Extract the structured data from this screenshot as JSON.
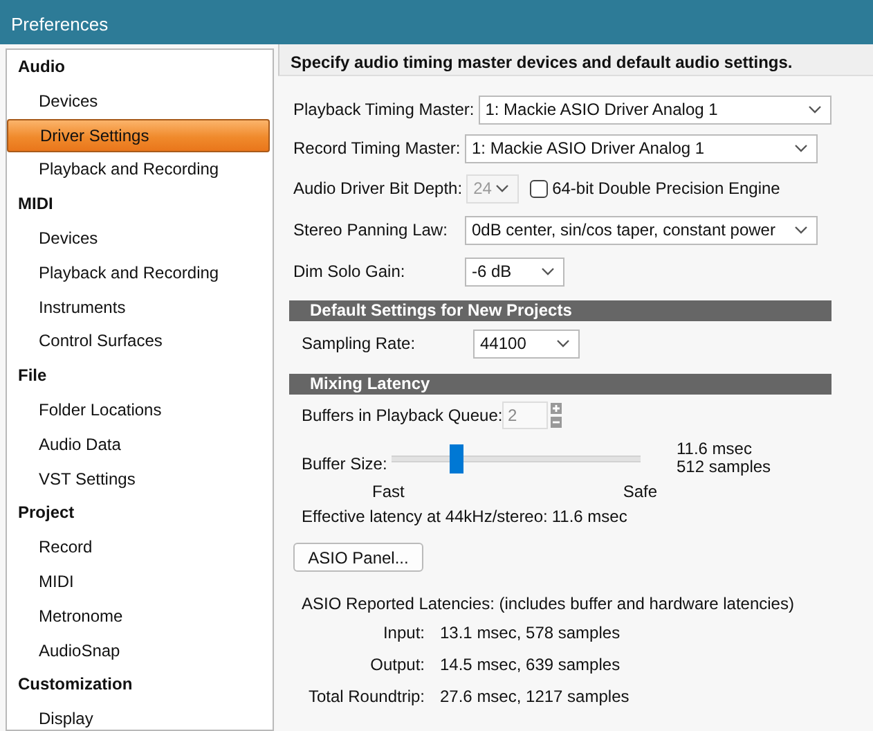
{
  "window": {
    "title": "Preferences"
  },
  "sidebar": {
    "categories": [
      {
        "label": "Audio",
        "items": [
          {
            "label": "Devices",
            "selected": false
          },
          {
            "label": "Driver Settings",
            "selected": true
          },
          {
            "label": "Playback and Recording",
            "selected": false
          }
        ]
      },
      {
        "label": "MIDI",
        "items": [
          {
            "label": "Devices",
            "selected": false
          },
          {
            "label": "Playback and Recording",
            "selected": false
          },
          {
            "label": "Instruments",
            "selected": false
          },
          {
            "label": "Control Surfaces",
            "selected": false
          }
        ]
      },
      {
        "label": "File",
        "items": [
          {
            "label": "Folder Locations",
            "selected": false
          },
          {
            "label": "Audio Data",
            "selected": false
          },
          {
            "label": "VST Settings",
            "selected": false
          }
        ]
      },
      {
        "label": "Project",
        "items": [
          {
            "label": "Record",
            "selected": false
          },
          {
            "label": "MIDI",
            "selected": false
          },
          {
            "label": "Metronome",
            "selected": false
          },
          {
            "label": "AudioSnap",
            "selected": false
          }
        ]
      },
      {
        "label": "Customization",
        "items": [
          {
            "label": "Display",
            "selected": false
          }
        ]
      }
    ]
  },
  "panel": {
    "header": "Specify audio timing master devices and default audio settings.",
    "fields": [
      {
        "kind": "wide",
        "label": "Playback Timing Master:",
        "value": "1: Mackie ASIO Driver Analog 1",
        "disabled": false
      },
      {
        "kind": "narrow",
        "label": "Audio Driver Bit Depth:",
        "value": "24",
        "disabled": true,
        "checkbox": {
          "label": "64-bit Double Precision Engine",
          "checked": false
        }
      },
      {
        "kind": "wide",
        "label": "Stereo Panning Law:",
        "value": "0dB center, sin/cos taper, constant power",
        "disabled": false
      },
      {
        "kind": "medium",
        "label": "Dim Solo Gain:",
        "value": "-6 dB",
        "disabled": false
      }
    ],
    "record_field": {
      "label": "Record Timing Master:",
      "value": "1: Mackie ASIO Driver Analog 1"
    },
    "defaults": {
      "title": "Default Settings for New Projects",
      "label": "Sampling Rate:",
      "value": "44100"
    },
    "latency": {
      "title": "Mixing Latency",
      "buffers_label": "Buffers in Playback Queue:",
      "buffers_value": "2",
      "buffers_disabled": true,
      "slider": {
        "label": "Buffer Size:",
        "level": 0.26,
        "reading": "11.6 msec",
        "samples": "512 samples",
        "min_label": "Fast",
        "max_label": "Safe"
      },
      "effective_label": "Effective latency at 44kHz/stereo:",
      "effective_value": "11.6 msec",
      "button": "ASIO Panel...",
      "reported_caption": "ASIO Reported Latencies: (includes buffer and hardware latencies)",
      "reported": [
        {
          "label": "Input:",
          "value": "13.1 msec, 578 samples"
        },
        {
          "label": "Output:",
          "value": "14.5 msec, 639 samples"
        },
        {
          "label": "Total Roundtrip:",
          "value": "27.6 msec, 1217 samples"
        }
      ]
    }
  }
}
